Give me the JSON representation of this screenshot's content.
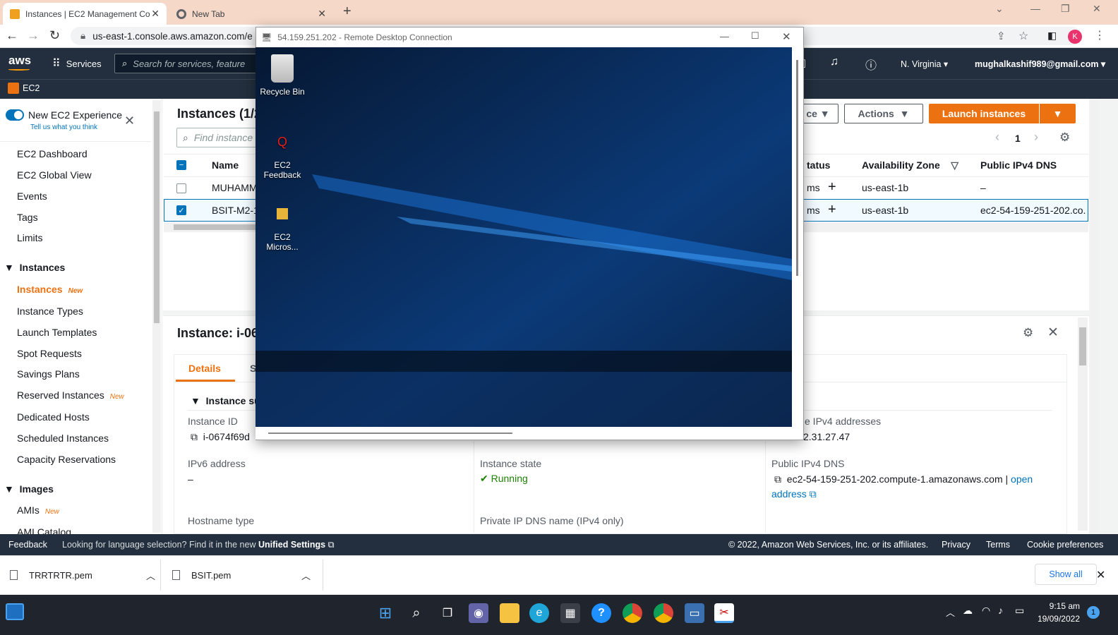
{
  "browser": {
    "tabs": [
      {
        "title": "Instances | EC2 Management Co"
      },
      {
        "title": "New Tab"
      }
    ],
    "url": "us-east-1.console.aws.amazon.com/e",
    "profile_initial": "K"
  },
  "aws_header": {
    "logo": "aws",
    "services": "Services",
    "search_placeholder": "Search for services, feature",
    "region": "N. Virginia",
    "account": "mughalkashif989@gmail.com",
    "service_name": "EC2"
  },
  "sidebar": {
    "new_experience": "New EC2 Experience",
    "feedback_link": "Tell us what you think",
    "items": [
      {
        "label": "EC2 Dashboard"
      },
      {
        "label": "EC2 Global View"
      },
      {
        "label": "Events"
      },
      {
        "label": "Tags"
      },
      {
        "label": "Limits"
      }
    ],
    "sections": [
      {
        "title": "Instances",
        "items": [
          {
            "label": "Instances",
            "badge": "New"
          },
          {
            "label": "Instance Types"
          },
          {
            "label": "Launch Templates"
          },
          {
            "label": "Spot Requests"
          },
          {
            "label": "Savings Plans"
          },
          {
            "label": "Reserved Instances",
            "badge": "New"
          },
          {
            "label": "Dedicated Hosts"
          },
          {
            "label": "Scheduled Instances"
          },
          {
            "label": "Capacity Reservations"
          }
        ]
      },
      {
        "title": "Images",
        "items": [
          {
            "label": "AMIs",
            "badge": "New"
          },
          {
            "label": "AMI Catalog"
          }
        ]
      }
    ]
  },
  "instances": {
    "title": "Instances (1/2",
    "search_placeholder": "Find instance",
    "partial_button": "ce",
    "actions": "Actions",
    "launch": "Launch instances",
    "page": "1",
    "columns": {
      "name": "Name",
      "status": "tatus",
      "az": "Availability Zone",
      "dns": "Public IPv4 DNS"
    },
    "rows": [
      {
        "name": "MUHAMM",
        "status": "ms",
        "az": "us-east-1b",
        "dns": "–",
        "selected": false
      },
      {
        "name": "BSIT-M2-1",
        "status": "ms",
        "az": "us-east-1b",
        "dns": "ec2-54-159-251-202.co.",
        "selected": true
      }
    ]
  },
  "details": {
    "title": "Instance: i-06",
    "tabs": [
      "Details",
      "S"
    ],
    "summary": "Instance su",
    "fields": {
      "instance_id_label": "Instance ID",
      "instance_id_value": "i-0674f69d",
      "private_ipv4_label": "e IPv4 addresses",
      "private_ipv4_value": "2.31.27.47",
      "ipv6_label": "IPv6 address",
      "ipv6_value": "–",
      "state_label": "Instance state",
      "state_value": "Running",
      "public_dns_label": "Public IPv4 DNS",
      "public_dns_value": "ec2-54-159-251-202.compute-1.amazonaws.com",
      "public_dns_sep": "|",
      "open_label": "open",
      "address_label": "address",
      "hostname_label": "Hostname type",
      "private_dns_label": "Private IP DNS name (IPv4 only)"
    }
  },
  "aws_footer": {
    "feedback": "Feedback",
    "language_text": "Looking for language selection? Find it in the new",
    "unified": "Unified Settings",
    "copyright": "© 2022, Amazon Web Services, Inc. or its affiliates.",
    "privacy": "Privacy",
    "terms": "Terms",
    "cookies": "Cookie preferences"
  },
  "downloads": {
    "items": [
      {
        "name": "TRRTRTR.pem"
      },
      {
        "name": "BSIT.pem"
      }
    ],
    "show_all": "Show all"
  },
  "rdp": {
    "title": "54.159.251.202 - Remote Desktop Connection",
    "icons": [
      {
        "label": "Recycle Bin"
      },
      {
        "label": "EC2 Feedback"
      },
      {
        "label": "EC2 Micros..."
      }
    ]
  },
  "taskbar": {
    "time": "9:15 am",
    "date": "19/09/2022",
    "notification_count": "1"
  },
  "colors": {
    "aws_dark": "#232f3e",
    "aws_orange": "#ec7211",
    "link_blue": "#0073bb",
    "running_green": "#1d8102"
  }
}
